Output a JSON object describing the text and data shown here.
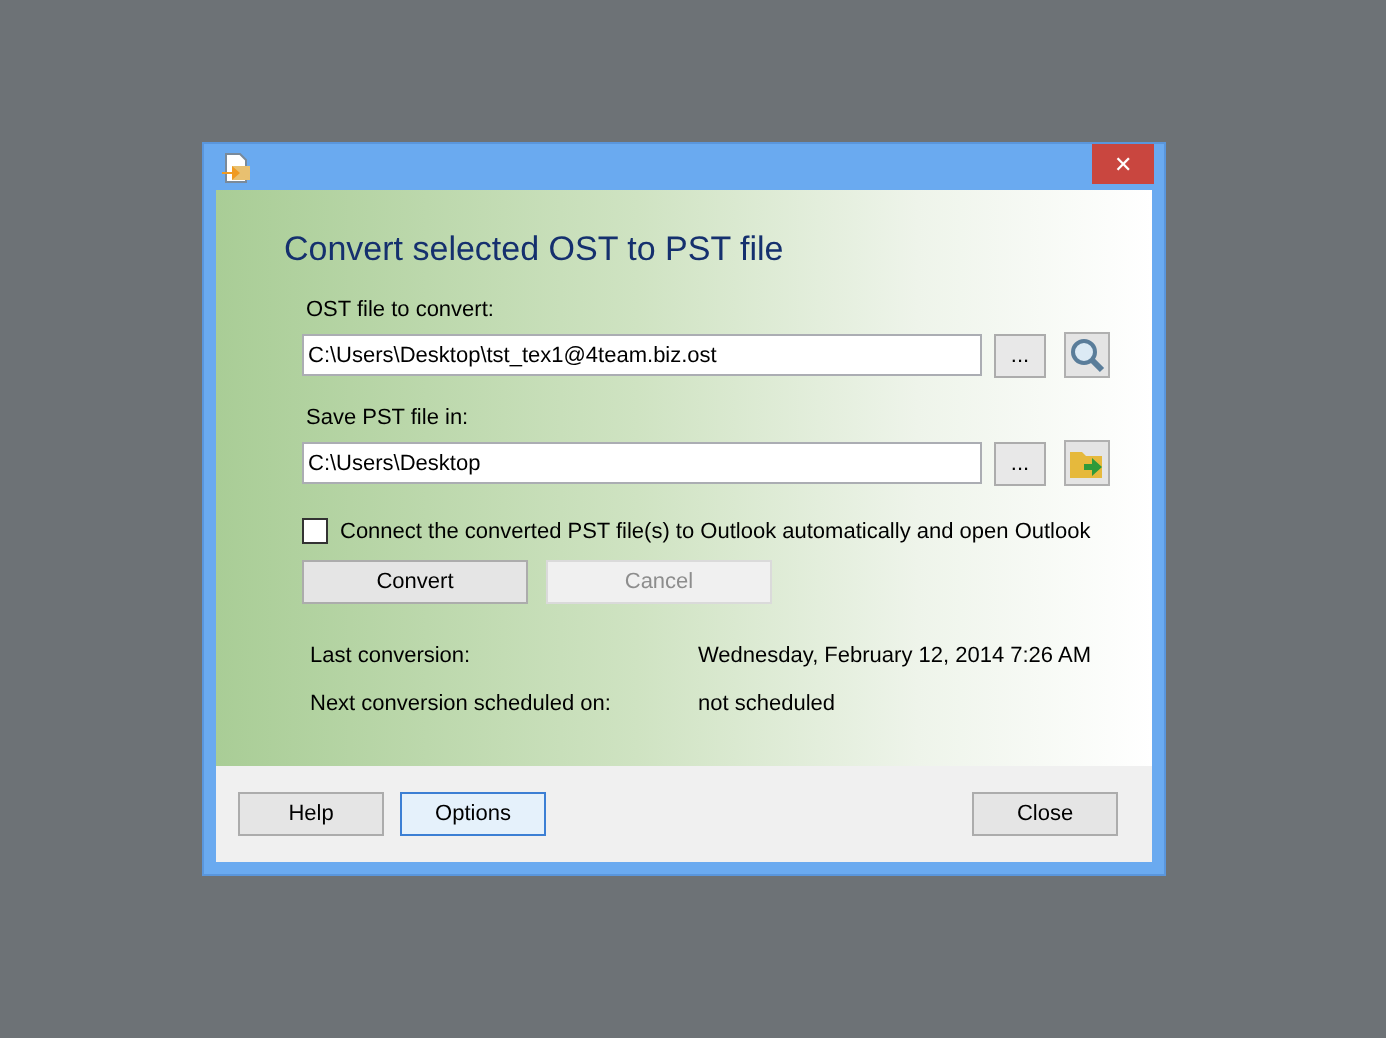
{
  "heading": "Convert selected OST to PST file",
  "fields": [
    {
      "label": "OST file to convert:",
      "value": "C:\\Users\\Desktop\\tst_tex1@4team.biz.ost",
      "browse": "...",
      "kind": "search"
    },
    {
      "label": "Save PST file in:",
      "value": "C:\\Users\\Desktop",
      "browse": "...",
      "kind": "folder"
    }
  ],
  "auto_connect": {
    "label": "Connect the converted PST file(s) to Outlook automatically and open Outlook",
    "checked": false
  },
  "actions": [
    {
      "label": "Convert",
      "disabled": false
    },
    {
      "label": "Cancel",
      "disabled": true
    }
  ],
  "info": [
    {
      "label": "Last conversion:",
      "value": "Wednesday, February 12, 2014 7:26 AM"
    },
    {
      "label": "Next conversion scheduled on:",
      "value": "not scheduled"
    }
  ],
  "footer": {
    "left": [
      {
        "label": "Help",
        "focused": false
      },
      {
        "label": "Options",
        "focused": true
      }
    ],
    "right": [
      {
        "label": "Close",
        "focused": false
      }
    ]
  },
  "close_glyph": "✕"
}
